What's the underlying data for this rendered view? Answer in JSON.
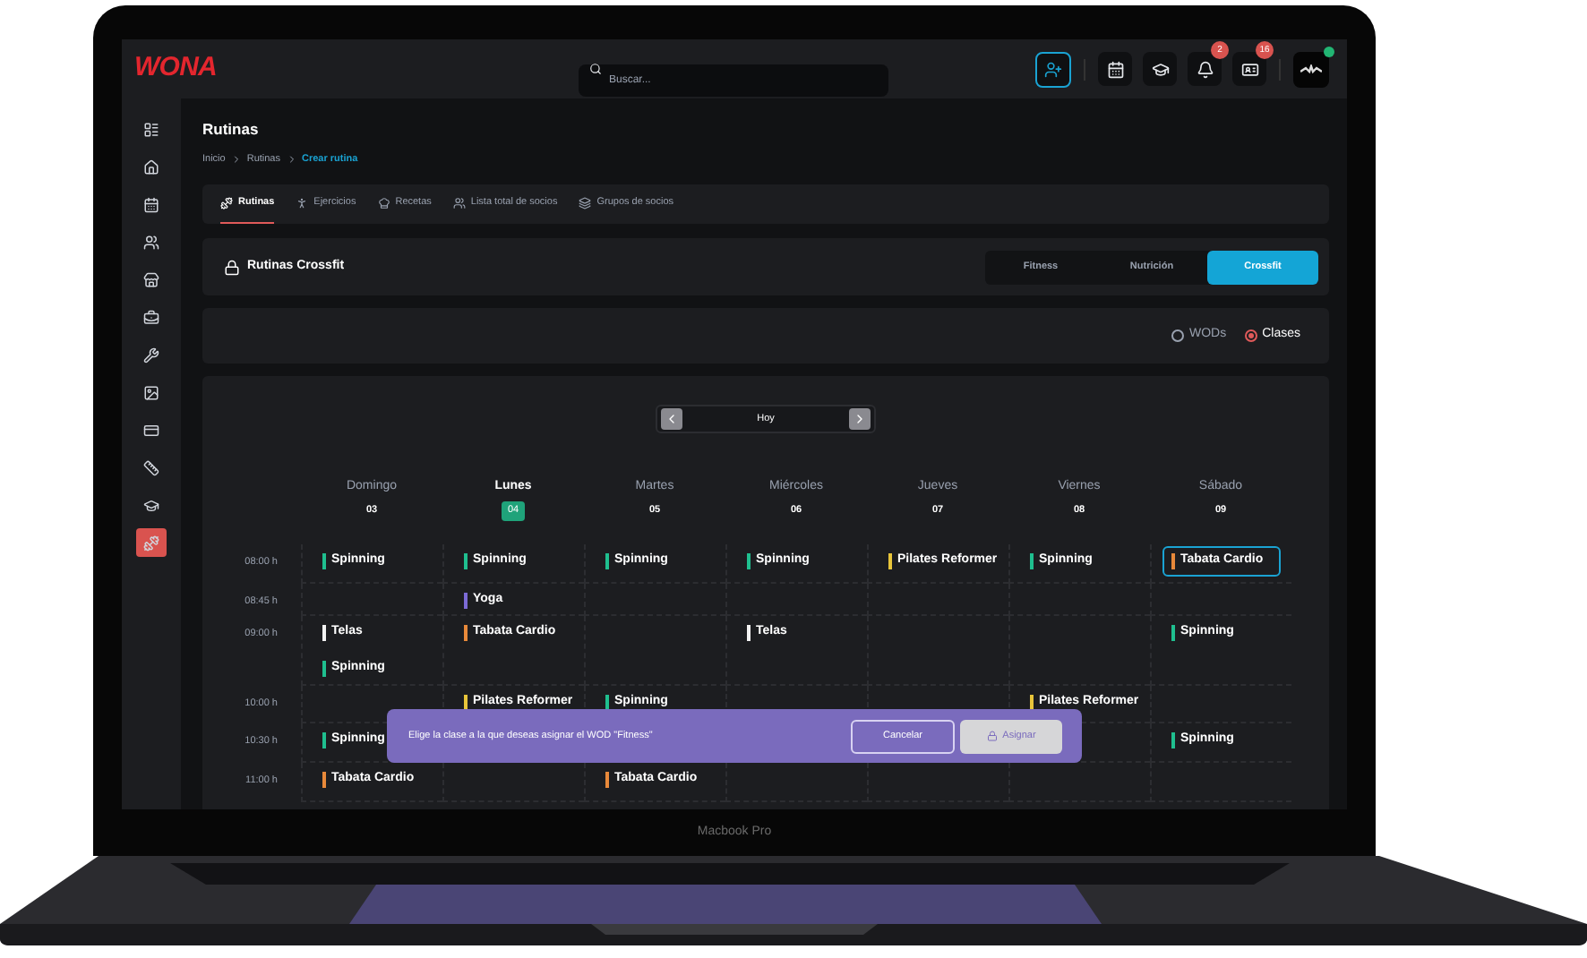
{
  "header": {
    "logo": "WONA",
    "search": {
      "placeholder": "Buscar..."
    },
    "notifications": {
      "badge": "2"
    },
    "messages": {
      "badge": "16"
    },
    "profile": {
      "online": true
    }
  },
  "sidebar": {
    "items": [
      {
        "selected": false
      },
      {
        "selected": false
      },
      {
        "selected": false
      },
      {
        "selected": false
      },
      {
        "selected": false
      },
      {
        "selected": false
      },
      {
        "selected": false
      },
      {
        "selected": false
      },
      {
        "selected": false
      },
      {
        "selected": false
      },
      {
        "selected": false
      },
      {
        "selected": true
      }
    ]
  },
  "page": {
    "title": "Rutinas",
    "breadcrumb": [
      {
        "label": "Inicio",
        "current": false
      },
      {
        "label": "Rutinas",
        "current": false
      },
      {
        "label": "Crear rutina",
        "current": true
      }
    ]
  },
  "tabs": [
    {
      "label": "Rutinas",
      "selected": true
    },
    {
      "label": "Ejercicios",
      "selected": false
    },
    {
      "label": "Recetas",
      "selected": false
    },
    {
      "label": "Lista total de socios",
      "selected": false
    },
    {
      "label": "Grupos de socios",
      "selected": false
    }
  ],
  "section": {
    "title": "Rutinas Crossfit",
    "segments": [
      {
        "label": "Fitness",
        "selected": false
      },
      {
        "label": "Nutrición",
        "selected": false
      },
      {
        "label": "Crossfit",
        "selected": true
      }
    ]
  },
  "view_options": [
    {
      "label": "WODs",
      "selected": false
    },
    {
      "label": "Clases",
      "selected": true
    }
  ],
  "calendar": {
    "today_label": "Hoy",
    "days": [
      {
        "name": "Domingo",
        "date": "03",
        "selected": false
      },
      {
        "name": "Lunes",
        "date": "04",
        "selected": true
      },
      {
        "name": "Martes",
        "date": "05",
        "selected": false
      },
      {
        "name": "Miércoles",
        "date": "06",
        "selected": false
      },
      {
        "name": "Jueves",
        "date": "07",
        "selected": false
      },
      {
        "name": "Viernes",
        "date": "08",
        "selected": false
      },
      {
        "name": "Sábado",
        "date": "09",
        "selected": false
      }
    ],
    "rows": [
      {
        "time": "08:00 h",
        "cells": [
          [
            {
              "name": "Spinning",
              "color": "#1fbf8f",
              "selected": false
            }
          ],
          [
            {
              "name": "Spinning",
              "color": "#1fbf8f",
              "selected": false
            }
          ],
          [
            {
              "name": "Spinning",
              "color": "#1fbf8f",
              "selected": false
            }
          ],
          [
            {
              "name": "Spinning",
              "color": "#1fbf8f",
              "selected": false
            }
          ],
          [
            {
              "name": "Pilates Reformer",
              "color": "#e8c53a",
              "selected": false
            }
          ],
          [
            {
              "name": "Spinning",
              "color": "#1fbf8f",
              "selected": false
            }
          ],
          [
            {
              "name": "Tabata Cardio",
              "color": "#e8893a",
              "selected": true
            }
          ]
        ]
      },
      {
        "time": "08:45 h",
        "cells": [
          [],
          [
            {
              "name": "Yoga",
              "color": "#7c6bd6",
              "selected": false
            }
          ],
          [],
          [],
          [],
          [],
          []
        ]
      },
      {
        "time": "09:00 h",
        "cells": [
          [
            {
              "name": "Telas",
              "color": "#f2f2f2",
              "selected": false
            },
            {
              "name": "Spinning",
              "color": "#1fbf8f",
              "selected": false
            }
          ],
          [
            {
              "name": "Tabata Cardio",
              "color": "#e8893a",
              "selected": false
            }
          ],
          [],
          [
            {
              "name": "Telas",
              "color": "#f2f2f2",
              "selected": false
            }
          ],
          [],
          [],
          [
            {
              "name": "Spinning",
              "color": "#1fbf8f",
              "selected": false
            }
          ]
        ]
      },
      {
        "time": "10:00 h",
        "cells": [
          [],
          [
            {
              "name": "Pilates Reformer",
              "color": "#e8c53a",
              "selected": false
            }
          ],
          [
            {
              "name": "Spinning",
              "color": "#1fbf8f",
              "selected": false
            }
          ],
          [],
          [],
          [
            {
              "name": "Pilates Reformer",
              "color": "#e8c53a",
              "selected": false
            }
          ],
          []
        ]
      },
      {
        "time": "10:30 h",
        "cells": [
          [
            {
              "name": "Spinning",
              "color": "#1fbf8f",
              "selected": false
            }
          ],
          [],
          [],
          [],
          [],
          [],
          [
            {
              "name": "Spinning",
              "color": "#1fbf8f",
              "selected": false
            }
          ]
        ]
      },
      {
        "time": "11:00 h",
        "cells": [
          [
            {
              "name": "Tabata Cardio",
              "color": "#e8893a",
              "selected": false
            }
          ],
          [],
          [
            {
              "name": "Tabata Cardio",
              "color": "#e8893a",
              "selected": false
            }
          ],
          [],
          [],
          [],
          []
        ]
      }
    ]
  },
  "assign_bar": {
    "message": "Elige la clase a la que deseas asignar el WOD \"Fitness\"",
    "cancel": "Cancelar",
    "assign": "Asignar",
    "assign_disabled": true
  },
  "device_label": "Macbook Pro"
}
